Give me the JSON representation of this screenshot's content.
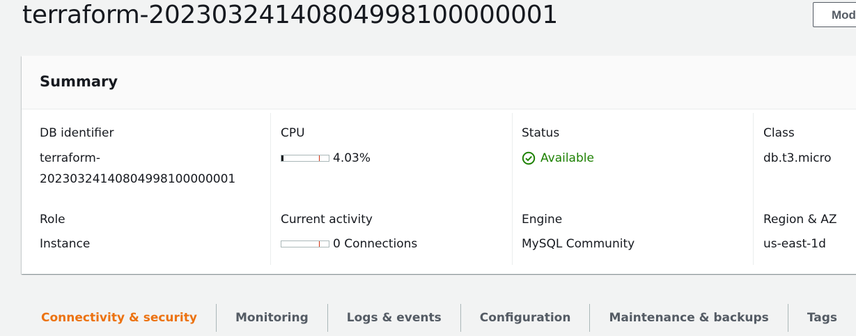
{
  "header": {
    "title": "terraform-20230324140804998100000001",
    "modify_label": "Modify"
  },
  "summary": {
    "title": "Summary",
    "db_identifier": {
      "label": "DB identifier",
      "value_line1": "terraform-",
      "value_line2": "20230324140804998100000001"
    },
    "cpu": {
      "label": "CPU",
      "value": "4.03%",
      "fraction": 0.0403
    },
    "status": {
      "label": "Status",
      "value": "Available",
      "color": "#1d8102"
    },
    "class": {
      "label": "Class",
      "value": "db.t3.micro"
    },
    "role": {
      "label": "Role",
      "value": "Instance"
    },
    "current_activity": {
      "label": "Current activity",
      "value": "0 Connections",
      "fraction": 0
    },
    "engine": {
      "label": "Engine",
      "value": "MySQL Community"
    },
    "region_az": {
      "label": "Region & AZ",
      "value": "us-east-1d"
    }
  },
  "tabs": [
    {
      "label": "Connectivity & security",
      "active": true
    },
    {
      "label": "Monitoring",
      "active": false
    },
    {
      "label": "Logs & events",
      "active": false
    },
    {
      "label": "Configuration",
      "active": false
    },
    {
      "label": "Maintenance & backups",
      "active": false
    },
    {
      "label": "Tags",
      "active": false
    }
  ],
  "colors": {
    "accent": "#ec7211",
    "success": "#1d8102",
    "meter": "#0073bb",
    "threshold": "#d13212"
  }
}
